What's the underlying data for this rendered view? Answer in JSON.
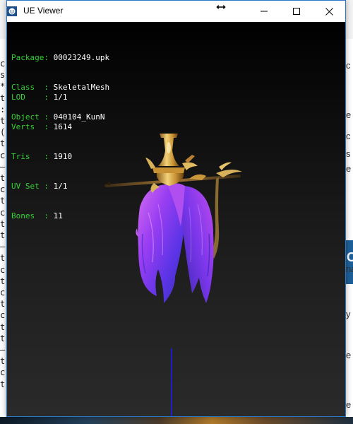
{
  "window": {
    "title": "UE Viewer"
  },
  "info_block_1": {
    "package_label": "Package:",
    "package_value": "00023249.upk",
    "class_label": "Class  :",
    "class_value": "SkeletalMesh",
    "object_label": "Object :",
    "object_value": "040104_KunN"
  },
  "info_block_2": {
    "lod_label": "LOD    :",
    "lod_value": "1/1",
    "verts_label": "Verts  :",
    "verts_value": "1614",
    "tris_label": "Tris   :",
    "tris_value": "1910",
    "uvset_label": "UV Set :",
    "uvset_value": "1/1",
    "bones_label": "Bones  :",
    "bones_value": "11"
  },
  "background_left_chars": [
    "c",
    "s",
    "*",
    "t",
    ":",
    "t",
    "(",
    "t",
    "c",
    "—",
    "t",
    "c",
    "t",
    "c",
    "t",
    "t",
    "—",
    "t",
    "c",
    "t",
    "c",
    "t",
    "c",
    "t",
    "t",
    "—",
    "t",
    "c",
    "t"
  ],
  "background_right": {
    "snippets": [
      "c",
      "e",
      "c",
      "s",
      "e",
      "na",
      "y",
      "e",
      "e"
    ],
    "bar_text": "C"
  },
  "colors": {
    "label_green": "#34d134",
    "value_white": "#ffffff",
    "hair_purple": "#7a3cff",
    "hair_magenta": "#c040e0",
    "gold": "#d4a640",
    "axis_blue": "#1a1aff",
    "window_border": "#2b78c6"
  },
  "icons": {
    "app": "ue-viewer-app-icon",
    "cursor": "horizontal-resize-cursor-icon",
    "minimize": "minimize-icon",
    "maximize": "maximize-icon",
    "close": "close-icon"
  }
}
